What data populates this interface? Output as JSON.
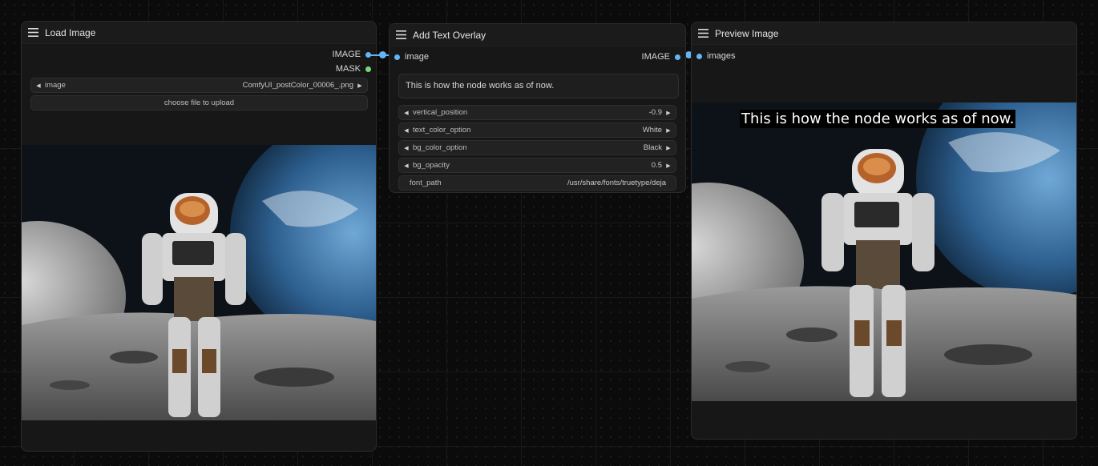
{
  "nodes": {
    "load_image": {
      "title": "Load Image",
      "outputs": [
        "IMAGE",
        "MASK"
      ],
      "widgets": {
        "image": {
          "label": "image",
          "value": "ComfyUI_postColor_00006_.png"
        },
        "upload_label": "choose file to upload"
      }
    },
    "add_text_overlay": {
      "title": "Add Text Overlay",
      "input": "image",
      "output": "IMAGE",
      "text": "This is how the node works as of now.",
      "widgets": [
        {
          "label": "vertical_position",
          "value": "-0.9"
        },
        {
          "label": "text_color_option",
          "value": "White"
        },
        {
          "label": "bg_color_option",
          "value": "Black"
        },
        {
          "label": "bg_opacity",
          "value": "0.5"
        },
        {
          "label": "font_path",
          "value": "/usr/share/fonts/truetype/deja"
        }
      ]
    },
    "preview_image": {
      "title": "Preview Image",
      "input": "images",
      "overlay_text": "This is how the node works as of now."
    }
  },
  "colors": {
    "image_wire": "#64b5f6",
    "mask_slot": "#7bd67a",
    "canvas_bg": "#0b0b0b",
    "node_bg": "#171717"
  },
  "icons": [
    "menu-icon",
    "chevron-left-icon",
    "chevron-right-icon"
  ]
}
